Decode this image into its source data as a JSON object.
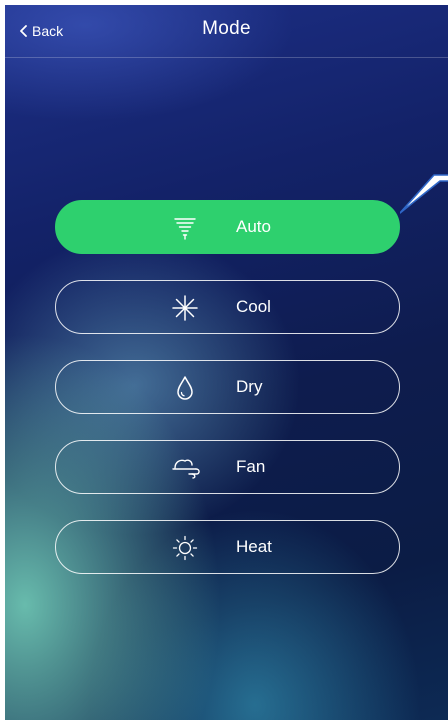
{
  "header": {
    "back_label": "Back",
    "title": "Mode"
  },
  "modes": [
    {
      "label": "Auto",
      "icon": "tornado-icon",
      "selected": true
    },
    {
      "label": "Cool",
      "icon": "snowflake-icon",
      "selected": false
    },
    {
      "label": "Dry",
      "icon": "water-drop-icon",
      "selected": false
    },
    {
      "label": "Fan",
      "icon": "wind-icon",
      "selected": false
    },
    {
      "label": "Heat",
      "icon": "sun-icon",
      "selected": false
    }
  ],
  "colors": {
    "active_mode": "#2ed06e",
    "background_top": "#1d2f87",
    "background_bottom": "#0b1c45",
    "text": "#ffffff",
    "callout": "#2f67c8"
  }
}
